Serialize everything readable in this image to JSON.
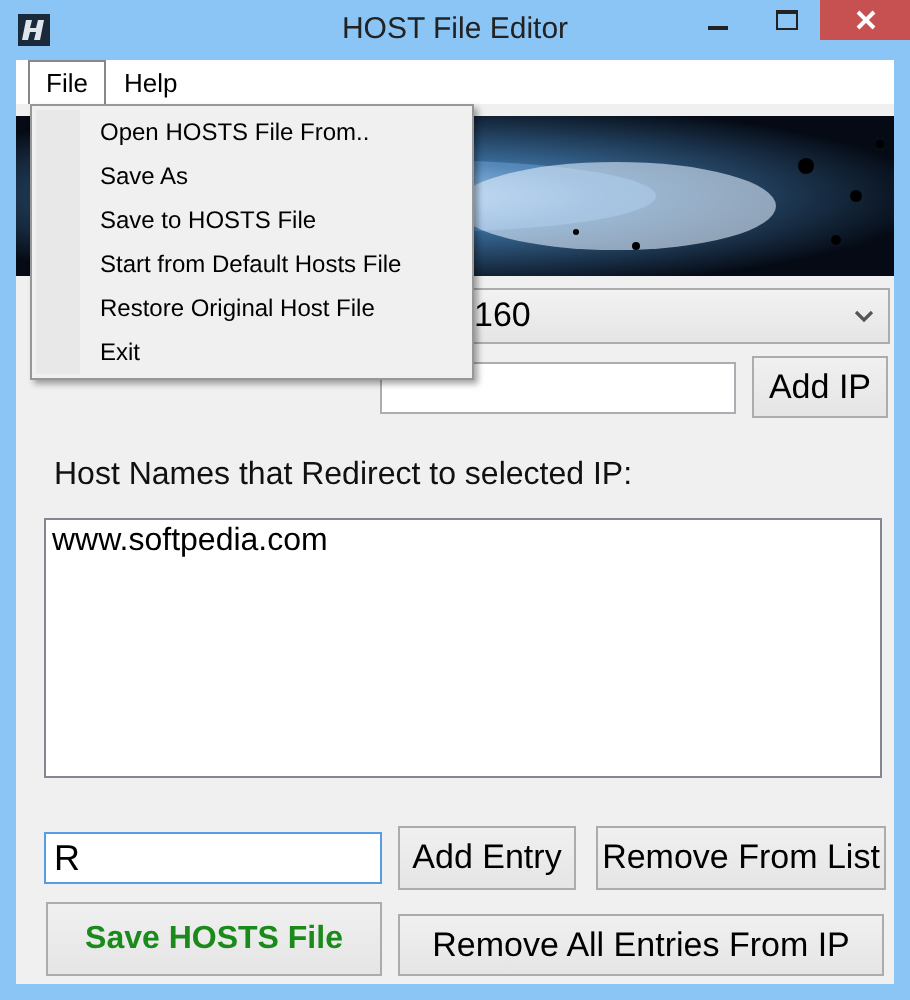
{
  "window": {
    "title": "HOST File Editor"
  },
  "menubar": [
    {
      "label": "File",
      "selected": true
    },
    {
      "label": "Help",
      "selected": false
    }
  ],
  "file_menu": {
    "items": [
      "Open HOSTS File From..",
      "Save As",
      "Save to HOSTS File",
      "Start from Default Hosts File",
      "Restore Original Host File",
      "Exit"
    ]
  },
  "banner": {
    "kind": "picture"
  },
  "ip_dropdown": {
    "value": "160"
  },
  "add_ip_button": "Add IP",
  "hostnames_label": "Host Names that Redirect to selected IP:",
  "hostnames_list": [
    "www.softpedia.com"
  ],
  "entry_field": {
    "value": "R"
  },
  "add_entry_button": "Add Entry",
  "remove_from_list_button": "Remove From List",
  "save_button": "Save HOSTS File",
  "remove_all_button": "Remove All Entries From IP"
}
